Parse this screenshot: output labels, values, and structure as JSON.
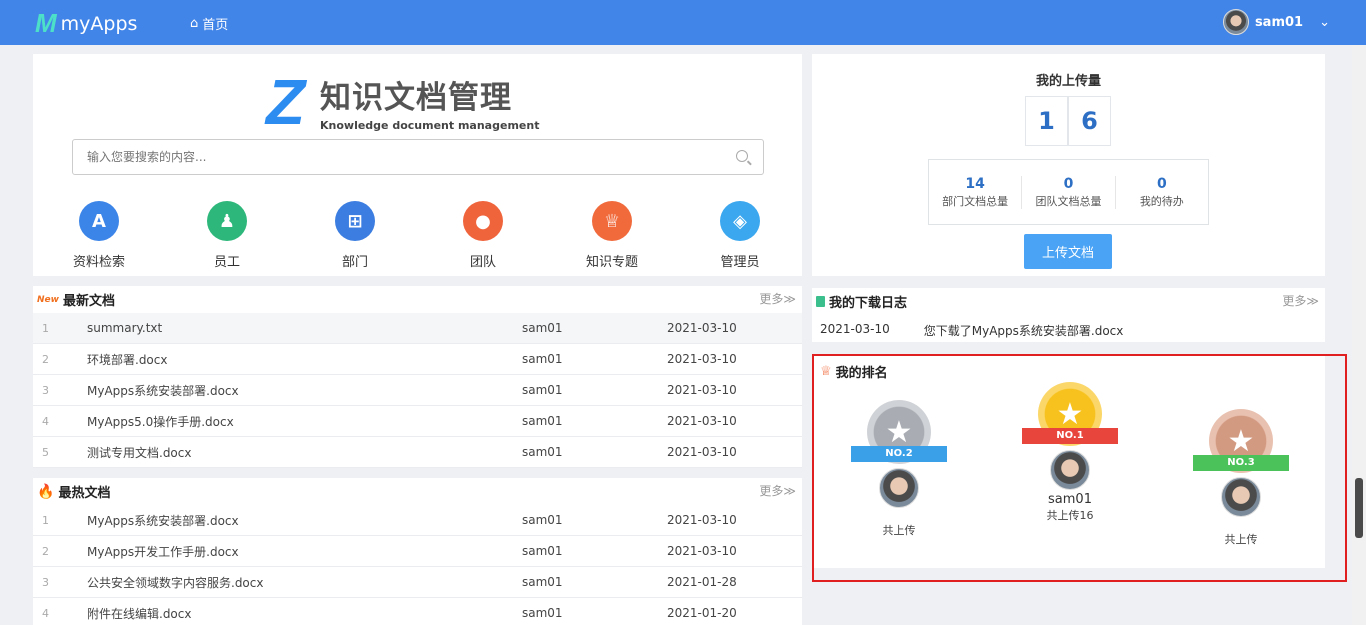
{
  "topbar": {
    "app_name": "myApps",
    "home_label": "首页",
    "user_name": "sam01"
  },
  "main": {
    "brand_title": "知识文档管理",
    "brand_subtitle": "Knowledge document management",
    "search_placeholder": "输入您要搜索的内容...",
    "quick_links": [
      {
        "label": "资料检索",
        "icon": "search-doc-icon",
        "color": "#3b84e8"
      },
      {
        "label": "员工",
        "icon": "employee-icon",
        "color": "#2db77a"
      },
      {
        "label": "部门",
        "icon": "org-chart-icon",
        "color": "#3b7de0"
      },
      {
        "label": "团队",
        "icon": "team-icon",
        "color": "#f0643c"
      },
      {
        "label": "知识专题",
        "icon": "trophy-icon",
        "color": "#f06a3c"
      },
      {
        "label": "管理员",
        "icon": "tag-icon",
        "color": "#3aa7ee"
      }
    ]
  },
  "upload": {
    "title": "我的上传量",
    "digits": [
      "1",
      "6"
    ],
    "stats": [
      {
        "value": "14",
        "label": "部门文档总量"
      },
      {
        "value": "0",
        "label": "团队文档总量"
      },
      {
        "value": "0",
        "label": "我的待办"
      }
    ],
    "button_label": "上传文档"
  },
  "latest": {
    "badge": "New",
    "title": "最新文档",
    "more": "更多≫",
    "rows": [
      {
        "idx": "1",
        "name": "summary.txt",
        "author": "sam01",
        "date": "2021-03-10"
      },
      {
        "idx": "2",
        "name": "环境部署.docx",
        "author": "sam01",
        "date": "2021-03-10"
      },
      {
        "idx": "3",
        "name": "MyApps系统安装部署.docx",
        "author": "sam01",
        "date": "2021-03-10"
      },
      {
        "idx": "4",
        "name": "MyApps5.0操作手册.docx",
        "author": "sam01",
        "date": "2021-03-10"
      },
      {
        "idx": "5",
        "name": "测试专用文档.docx",
        "author": "sam01",
        "date": "2021-03-10"
      }
    ]
  },
  "hot": {
    "title": "最热文档",
    "more": "更多≫",
    "rows": [
      {
        "idx": "1",
        "name": "MyApps系统安装部署.docx",
        "author": "sam01",
        "date": "2021-03-10"
      },
      {
        "idx": "2",
        "name": "MyApps开发工作手册.docx",
        "author": "sam01",
        "date": "2021-03-10"
      },
      {
        "idx": "3",
        "name": "公共安全领域数字内容服务.docx",
        "author": "sam01",
        "date": "2021-01-28"
      },
      {
        "idx": "4",
        "name": "附件在线编辑.docx",
        "author": "sam01",
        "date": "2021-01-20"
      }
    ]
  },
  "download_log": {
    "title": "我的下载日志",
    "more": "更多≫",
    "entry": {
      "date": "2021-03-10",
      "text": "您下载了MyApps系统安装部署.docx"
    }
  },
  "ranking": {
    "title": "我的排名",
    "first": {
      "badge": "NO.1",
      "name": "sam01",
      "total": "共上传16",
      "color": "#f5b52a",
      "ribbon": "#e8453c"
    },
    "second": {
      "badge": "NO.2",
      "name": "",
      "total": "共上传",
      "color": "#bfc3c9",
      "ribbon": "#3aa0e8"
    },
    "third": {
      "badge": "NO.3",
      "name": "",
      "total": "共上传",
      "color": "#d9a08a",
      "ribbon": "#4cc25a"
    }
  }
}
